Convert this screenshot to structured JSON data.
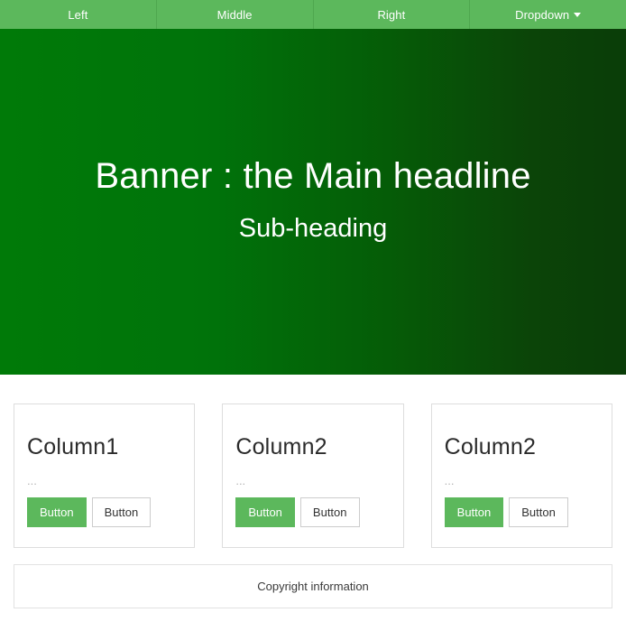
{
  "colors": {
    "nav_background": "#5cb85c",
    "nav_divider": "#4fa74f",
    "banner_gradient_start": "#007a08",
    "banner_gradient_end": "#0a3d08",
    "primary_button": "#5cb85c",
    "card_border": "#dddddd",
    "page_background": "#ffffff"
  },
  "navbar": {
    "items": [
      {
        "label": "Left",
        "name": "nav-item-left",
        "has_caret": false
      },
      {
        "label": "Middle",
        "name": "nav-item-middle",
        "has_caret": false
      },
      {
        "label": "Right",
        "name": "nav-item-right",
        "has_caret": false
      },
      {
        "label": "Dropdown",
        "name": "nav-item-dropdown",
        "has_caret": true,
        "caret_icon": "chevron-down-icon"
      }
    ]
  },
  "banner": {
    "title": "Banner : the Main headline",
    "subtitle": "Sub-heading"
  },
  "cards": [
    {
      "title": "Column1",
      "text": "...",
      "primary_button": "Button",
      "secondary_button": "Button"
    },
    {
      "title": "Column2",
      "text": "...",
      "primary_button": "Button",
      "secondary_button": "Button"
    },
    {
      "title": "Column2",
      "text": "...",
      "primary_button": "Button",
      "secondary_button": "Button"
    }
  ],
  "footer": {
    "text": "Copyright information"
  }
}
